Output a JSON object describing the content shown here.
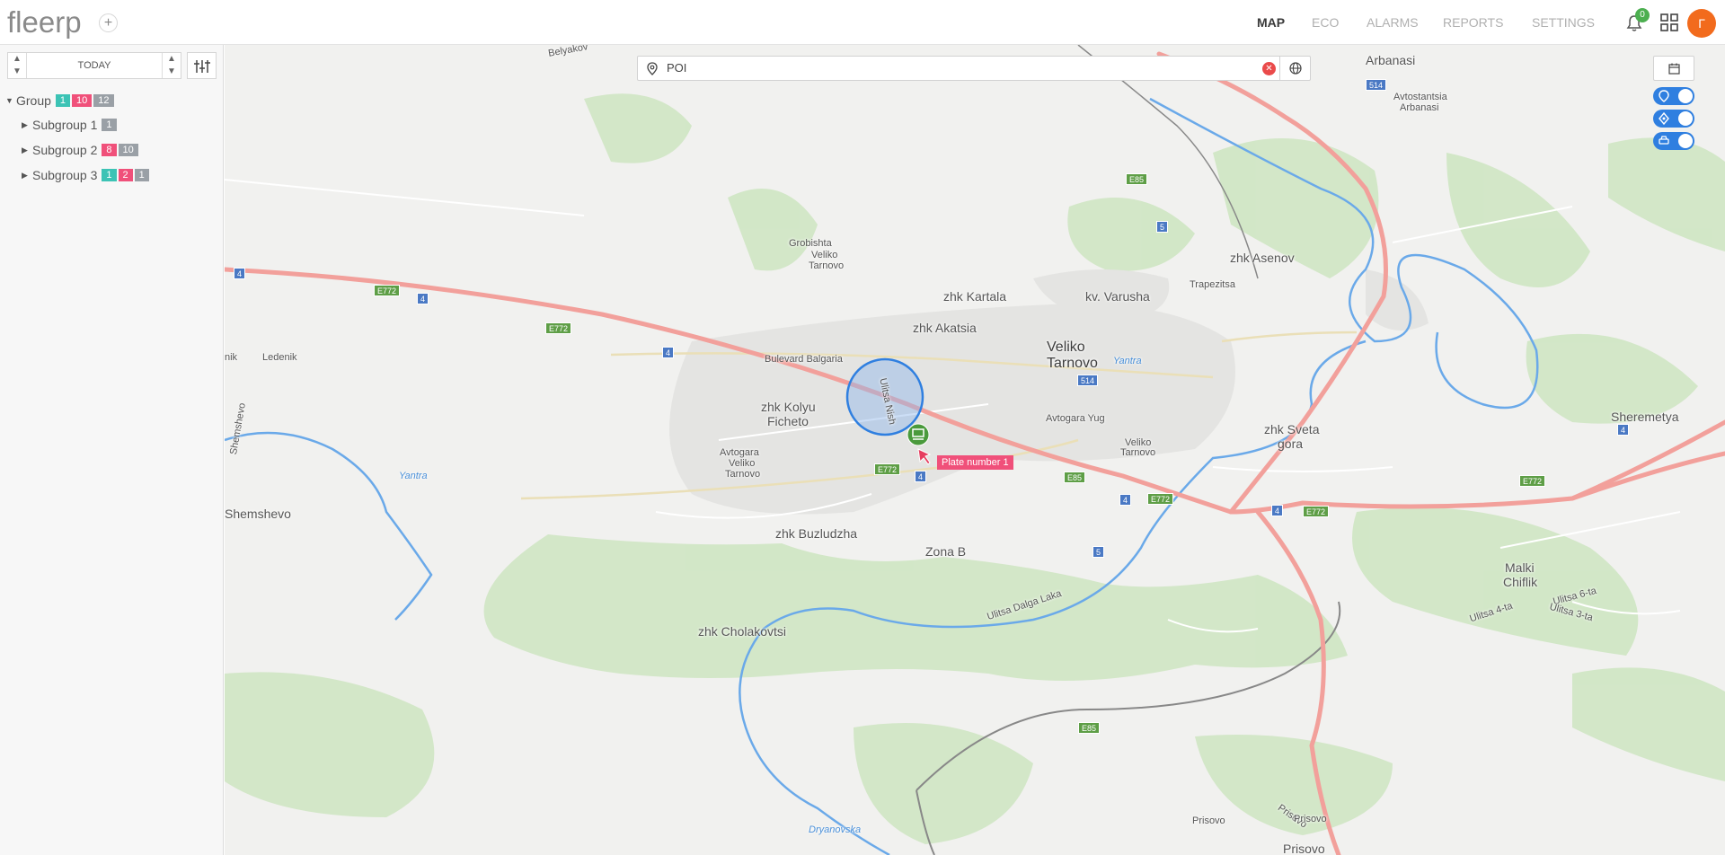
{
  "app": {
    "logo": "fleerp",
    "add_symbol": "+"
  },
  "nav": {
    "items": [
      {
        "label": "MAP",
        "active": true
      },
      {
        "label": "ECO",
        "active": false
      },
      {
        "label": "ALARMS",
        "active": false
      },
      {
        "label": "REPORTS",
        "active": false
      },
      {
        "label": "SETTINGS",
        "active": false
      }
    ],
    "notifications_count": "0",
    "avatar_initial": "Г"
  },
  "sidebar": {
    "date_label": "TODAY",
    "tree": [
      {
        "label": "Group",
        "expanded": true,
        "counts": [
          {
            "value": "1",
            "color": "teal"
          },
          {
            "value": "10",
            "color": "red"
          },
          {
            "value": "12",
            "color": "gray"
          }
        ]
      },
      {
        "label": "Subgroup 1",
        "expanded": false,
        "counts": [
          {
            "value": "1",
            "color": "gray"
          }
        ]
      },
      {
        "label": "Subgroup 2",
        "expanded": false,
        "counts": [
          {
            "value": "8",
            "color": "red"
          },
          {
            "value": "10",
            "color": "gray"
          }
        ]
      },
      {
        "label": "Subgroup 3",
        "expanded": false,
        "counts": [
          {
            "value": "1",
            "color": "teal"
          },
          {
            "value": "2",
            "color": "red"
          },
          {
            "value": "1",
            "color": "gray"
          }
        ]
      }
    ]
  },
  "map": {
    "search": {
      "text": "POI"
    },
    "vehicle_label": "Plate number 1",
    "labels": {
      "veliko_tarnovo_1": "Veliko",
      "veliko_tarnovo_2": "Tarnovo",
      "zhk_kartala": "zhk Kartala",
      "kv_varusha": "kv. Varusha",
      "zhk_akatsia": "zhk Akatsia",
      "zhk_kolyu_1": "zhk Kolyu",
      "zhk_kolyu_2": "Ficheto",
      "zhk_buzludzha": "zhk Buzludzha",
      "zona_b": "Zona B",
      "zhk_cholakovtsi": "zhk Cholakovtsi",
      "zhk_asenov": "zhk Asenov",
      "zhk_sveta_1": "zhk Sveta",
      "zhk_sveta_2": "gora",
      "arbanasi": "Arbanasi",
      "sheremetya": "Sheremetya",
      "malki_1": "Malki",
      "malki_2": "Chiflik",
      "shemshevo": "Shemshevo",
      "shemshevo_small": "Shemshevo",
      "ledenik": "Ledenik",
      "prisovo": "Prisovo",
      "prisovo_small_1": "Prisovo",
      "prisovo_small_2": "Prisovo",
      "prisovo_small_3": "Prisovo",
      "grobishta_1": "Grobishta",
      "grobishta_2": "Veliko",
      "grobishta_3": "Tarnovo",
      "avtogara_vt_1": "Avtogara",
      "avtogara_vt_2": "Veliko",
      "avtogara_vt_3": "Tarnovo",
      "avtogara_yug": "Avtogara Yug",
      "veliko_tarnovo_st_1": "Veliko",
      "veliko_tarnovo_st_2": "Tarnovo",
      "avtostantsia_1": "Avtostantsia",
      "avtostantsia_2": "Arbanasi",
      "trapezitsa": "Trapezitsa",
      "bulevard": "Bulevard Balgaria",
      "ulitsa_nish": "Ulitsa Nish",
      "ulitsa_dalga_laka": "Ulitsa Dalga Laka",
      "ulitsa_6ta": "Ulitsa 6-ta",
      "ulitsa_3ta": "Ulitsa 3-ta",
      "ulitsa_4ta": "Ulitsa 4-ta",
      "yantra_1": "Yantra",
      "yantra_2": "Yantra",
      "dryanovska": "Dryanovska",
      "belyakov": "Belyakov",
      "nik": "nik"
    },
    "shields": {
      "s4": "4",
      "s5": "5",
      "e85": "E85",
      "e772": "E772",
      "s514": "514"
    }
  }
}
